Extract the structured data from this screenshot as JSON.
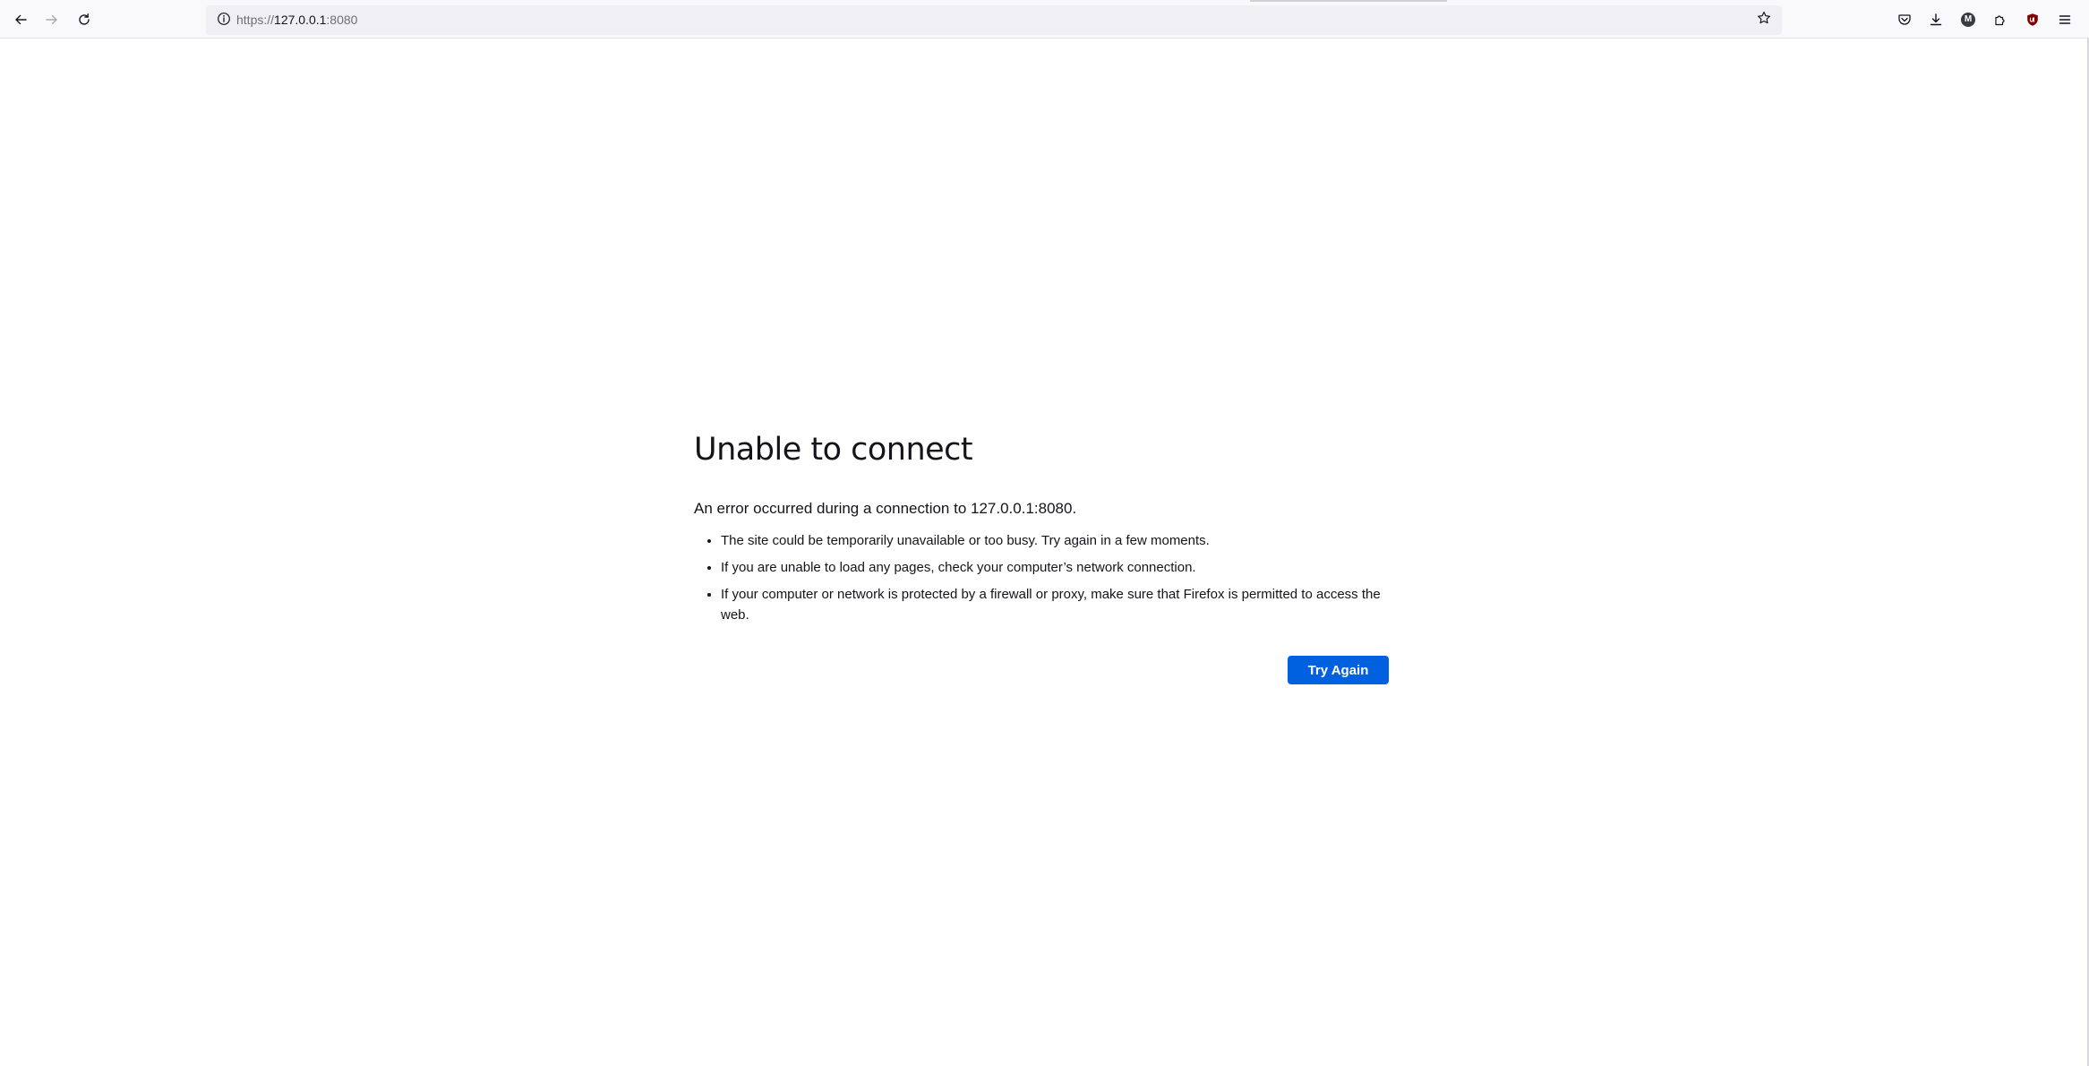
{
  "toolbar": {
    "url_scheme": "https://",
    "url_host": "127.0.0.1",
    "url_port": ":8080",
    "account_initial": "M"
  },
  "error": {
    "title": "Unable to connect",
    "description": "An error occurred during a connection to 127.0.0.1:8080.",
    "items": [
      "The site could be temporarily unavailable or too busy. Try again in a few moments.",
      "If you are unable to load any pages, check your computer’s network connection.",
      "If your computer or network is protected by a firewall or proxy, make sure that Firefox is permitted to access the web."
    ],
    "try_again_label": "Try Again"
  },
  "colors": {
    "accent": "#0061e0",
    "toolbar_bg": "#f9f9fb",
    "urlbar_bg": "#f0f0f4",
    "text": "#15141a"
  },
  "icons": {
    "back": "arrow-left-icon",
    "forward": "arrow-right-icon",
    "reload": "reload-icon",
    "site_info": "info-icon",
    "bookmark": "star-icon",
    "pocket": "pocket-icon",
    "downloads": "download-icon",
    "account": "account-icon",
    "extensions": "puzzle-icon",
    "ublock": "shield-icon",
    "menu": "hamburger-menu-icon"
  }
}
